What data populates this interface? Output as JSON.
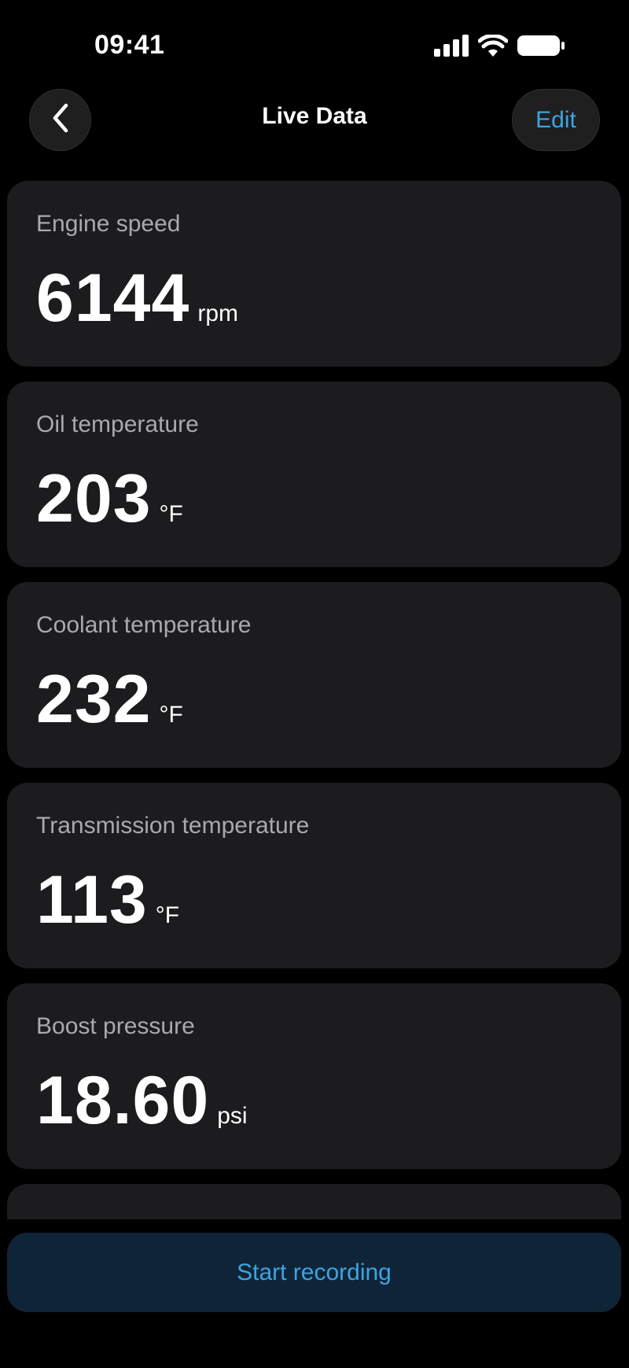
{
  "status_bar": {
    "time": "09:41",
    "icons": [
      "cellular-signal-icon",
      "wifi-icon",
      "battery-icon"
    ]
  },
  "nav": {
    "back_icon": "chevron-left-icon",
    "title": "Live Data",
    "edit_label": "Edit"
  },
  "metrics": [
    {
      "label": "Engine speed",
      "value": "6144",
      "unit": "rpm"
    },
    {
      "label": "Oil temperature",
      "value": "203",
      "unit": "°F"
    },
    {
      "label": "Coolant temperature",
      "value": "232",
      "unit": "°F"
    },
    {
      "label": "Transmission temperature",
      "value": "113",
      "unit": "°F"
    },
    {
      "label": "Boost pressure",
      "value": "18.60",
      "unit": "psi"
    }
  ],
  "footer": {
    "record_label": "Start recording"
  },
  "colors": {
    "background": "#000000",
    "card": "#1c1c1e",
    "accent": "#3fa3e0",
    "record_button_bg": "#0f2537",
    "label_gray": "#a9a9ae"
  }
}
